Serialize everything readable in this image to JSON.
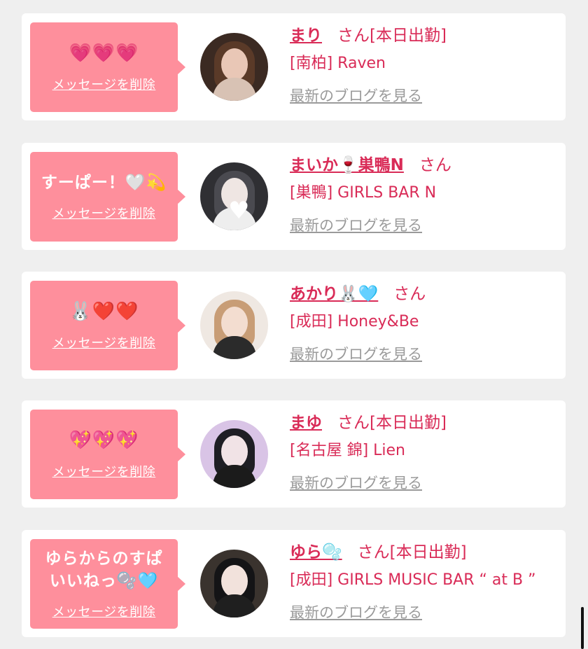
{
  "delete_label": "メッセージを削除",
  "san_label": "さん",
  "blog_label": "最新のブログを見る",
  "colors": {
    "bubble": "#fe8f9c",
    "name": "#d92b57",
    "blog_link": "#9a9a9a",
    "card": "#ffffff",
    "background": "#efefef"
  },
  "cards": [
    {
      "message": "💗💗💗",
      "name": "まり",
      "status": "[本日出勤]",
      "shop": "[南柏] Raven",
      "avatar_icon": "portrait-photo"
    },
    {
      "message": "すーぱー！🤍💫",
      "name": "まいか🍷巣鴨N",
      "status": "",
      "shop": "[巣鴨] GIRLS BAR N",
      "avatar_icon": "portrait-photo"
    },
    {
      "message": "🐰❤️❤️",
      "name": "あかり🐰🩵",
      "status": "",
      "shop": "[成田] Honey&Be",
      "avatar_icon": "portrait-photo"
    },
    {
      "message": "💖💖💖",
      "name": "まゆ",
      "status": "[本日出勤]",
      "shop": "[名古屋 錦] Lien",
      "avatar_icon": "portrait-photo"
    },
    {
      "message": "ゆらからのすぱいいねっ🫧🩵",
      "name": "ゆら🫧",
      "status": "[本日出勤]",
      "shop": "[成田] GIRLS MUSIC BAR “ at B ”",
      "avatar_icon": "portrait-photo"
    }
  ]
}
